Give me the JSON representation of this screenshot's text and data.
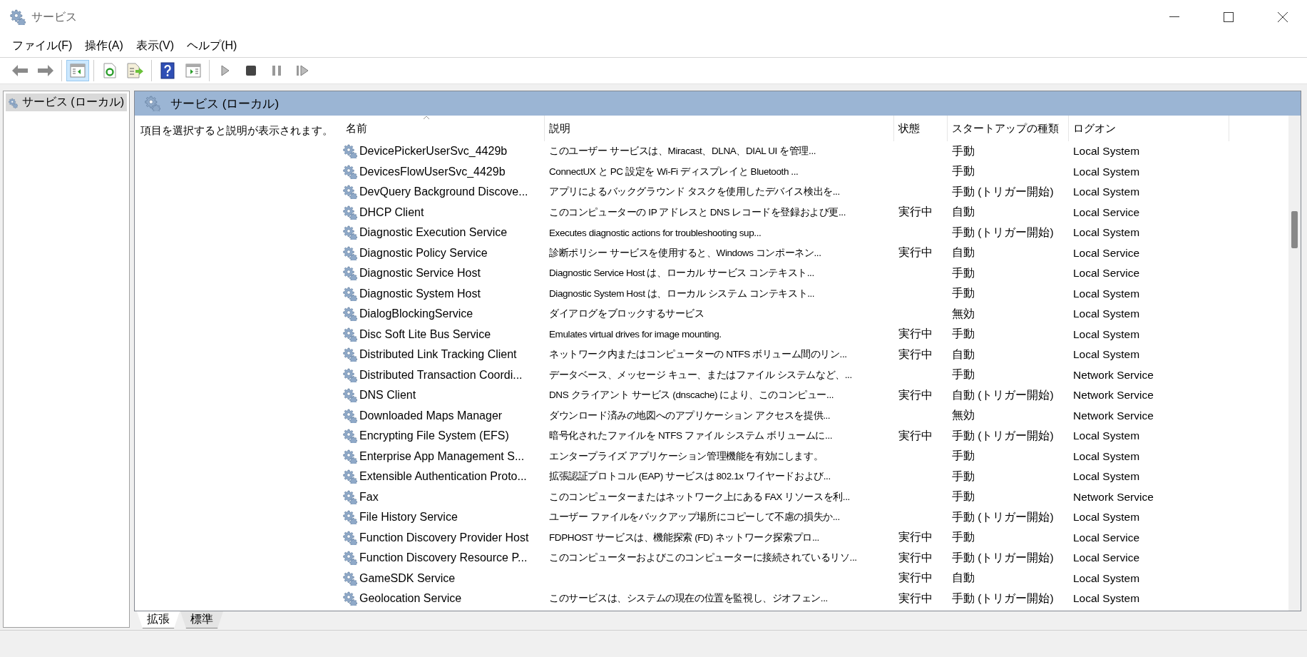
{
  "window": {
    "title": "サービス"
  },
  "menu": [
    "ファイル(F)",
    "操作(A)",
    "表示(V)",
    "ヘルプ(H)"
  ],
  "toolbar": [
    [
      {
        "kind": "back",
        "on": false
      },
      {
        "kind": "forward",
        "on": false
      }
    ],
    [
      {
        "kind": "tree",
        "on": true
      }
    ],
    [
      {
        "kind": "refresh",
        "on": false
      },
      {
        "kind": "export",
        "on": false
      }
    ],
    [
      {
        "kind": "help",
        "on": false
      },
      {
        "kind": "pane",
        "on": false
      }
    ],
    [
      {
        "kind": "play",
        "on": false
      },
      {
        "kind": "stop",
        "on": false
      },
      {
        "kind": "pause",
        "on": false
      },
      {
        "kind": "resume",
        "on": false
      }
    ]
  ],
  "tree": {
    "items": [
      {
        "label": "サービス (ローカル)",
        "selected": true
      }
    ]
  },
  "panel": {
    "title": "サービス (ローカル)",
    "hint": "項目を選択すると説明が表示されます。"
  },
  "table": {
    "columns": [
      {
        "label": "名前",
        "sorted": true
      },
      {
        "label": "説明",
        "sorted": false
      },
      {
        "label": "状態",
        "sorted": false
      },
      {
        "label": "スタートアップの種類",
        "sorted": false
      },
      {
        "label": "ログオン",
        "sorted": false
      }
    ],
    "rows": [
      [
        "DevicePickerUserSvc_4429b",
        "このユーザー サービスは、Miracast、DLNA、DIAL UI を管理...",
        "",
        "手動",
        "Local System"
      ],
      [
        "DevicesFlowUserSvc_4429b",
        "ConnectUX と PC 設定を Wi-Fi ディスプレイと Bluetooth ...",
        "",
        "手動",
        "Local System"
      ],
      [
        "DevQuery Background Discove...",
        "アプリによるバックグラウンド タスクを使用したデバイス検出を...",
        "",
        "手動 (トリガー開始)",
        "Local System"
      ],
      [
        "DHCP Client",
        "このコンピューターの IP アドレスと DNS レコードを登録および更...",
        "実行中",
        "自動",
        "Local Service"
      ],
      [
        "Diagnostic Execution Service",
        "Executes diagnostic actions for troubleshooting sup...",
        "",
        "手動 (トリガー開始)",
        "Local System"
      ],
      [
        "Diagnostic Policy Service",
        "診断ポリシー サービスを使用すると、Windows コンポーネン...",
        "実行中",
        "自動",
        "Local Service"
      ],
      [
        "Diagnostic Service Host",
        "Diagnostic Service Host は、ローカル サービス コンテキスト...",
        "",
        "手動",
        "Local Service"
      ],
      [
        "Diagnostic System Host",
        "Diagnostic System Host は、ローカル システム コンテキスト...",
        "",
        "手動",
        "Local System"
      ],
      [
        "DialogBlockingService",
        "ダイアログをブロックするサービス",
        "",
        "無効",
        "Local System"
      ],
      [
        "Disc Soft Lite Bus Service",
        "Emulates virtual drives for image mounting.",
        "実行中",
        "手動",
        "Local System"
      ],
      [
        "Distributed Link Tracking Client",
        "ネットワーク内またはコンピューターの NTFS ボリューム間のリン...",
        "実行中",
        "自動",
        "Local System"
      ],
      [
        "Distributed Transaction Coordi...",
        "データベース、メッセージ キュー、またはファイル システムなど、...",
        "",
        "手動",
        "Network Service"
      ],
      [
        "DNS Client",
        "DNS クライアント サービス (dnscache) により、このコンピュー...",
        "実行中",
        "自動 (トリガー開始)",
        "Network Service"
      ],
      [
        "Downloaded Maps Manager",
        "ダウンロード済みの地図へのアプリケーション アクセスを提供...",
        "",
        "無効",
        "Network Service"
      ],
      [
        "Encrypting File System (EFS)",
        "暗号化されたファイルを NTFS ファイル システム ボリュームに...",
        "実行中",
        "手動 (トリガー開始)",
        "Local System"
      ],
      [
        "Enterprise App Management S...",
        "エンタープライズ アプリケーション管理機能を有効にします。",
        "",
        "手動",
        "Local System"
      ],
      [
        "Extensible Authentication Proto...",
        "拡張認証プロトコル (EAP) サービスは 802.1x ワイヤードおよび...",
        "",
        "手動",
        "Local System"
      ],
      [
        "Fax",
        "このコンピューターまたはネットワーク上にある FAX リソースを利...",
        "",
        "手動",
        "Network Service"
      ],
      [
        "File History Service",
        "ユーザー ファイルをバックアップ場所にコピーして不慮の損失か...",
        "",
        "手動 (トリガー開始)",
        "Local System"
      ],
      [
        "Function Discovery Provider Host",
        "FDPHOST サービスは、機能探索 (FD) ネットワーク探索プロ...",
        "実行中",
        "手動",
        "Local Service"
      ],
      [
        "Function Discovery Resource P...",
        "このコンピューターおよびこのコンピューターに接続されているリソ...",
        "実行中",
        "手動 (トリガー開始)",
        "Local Service"
      ],
      [
        "GameSDK Service",
        "",
        "実行中",
        "自動",
        "Local System"
      ],
      [
        "Geolocation Service",
        "このサービスは、システムの現在の位置を監視し、ジオフェン...",
        "実行中",
        "手動 (トリガー開始)",
        "Local System"
      ]
    ]
  },
  "bottom_tabs": [
    {
      "label": "拡張",
      "selected": true
    },
    {
      "label": "標準",
      "selected": false
    }
  ]
}
